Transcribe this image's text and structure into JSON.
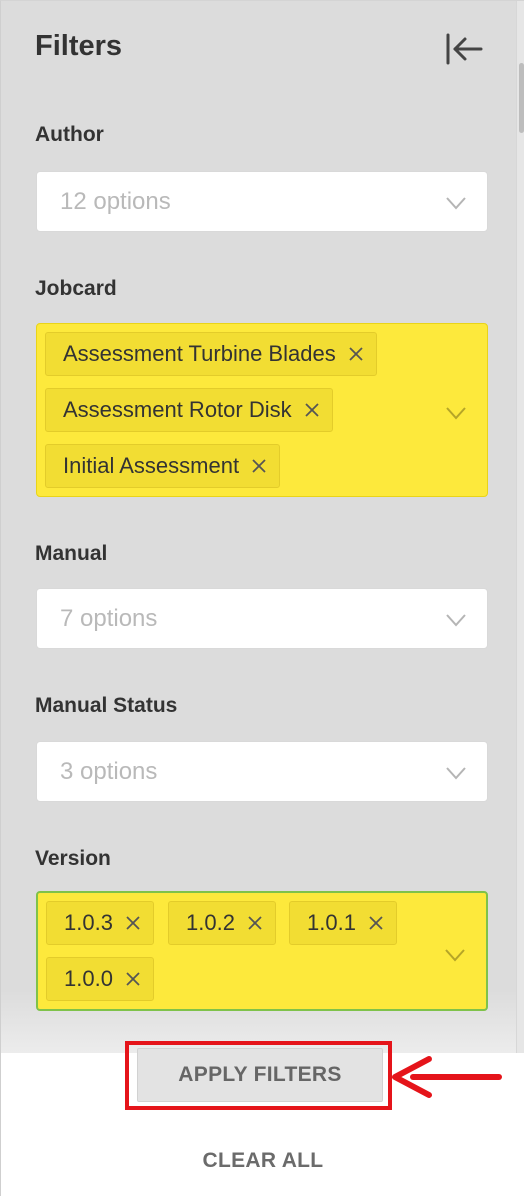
{
  "panel": {
    "title": "Filters",
    "collapse_icon": "collapse-left-icon"
  },
  "filters": {
    "author": {
      "label": "Author",
      "placeholder": "12 options"
    },
    "jobcard": {
      "label": "Jobcard",
      "tags": [
        "Assessment Turbine Blades",
        "Assessment Rotor Disk",
        "Initial Assessment"
      ]
    },
    "manual": {
      "label": "Manual",
      "placeholder": "7 options"
    },
    "manual_status": {
      "label": "Manual Status",
      "placeholder": "3 options"
    },
    "version": {
      "label": "Version",
      "tags": [
        "1.0.3",
        "1.0.2",
        "1.0.1",
        "1.0.0"
      ]
    }
  },
  "actions": {
    "apply_label": "APPLY FILTERS",
    "clear_label": "CLEAR ALL"
  },
  "icons": {
    "dropdown": "chevron-down-icon",
    "tag_remove": "close-icon",
    "annotation": "arrow-left-icon"
  },
  "colors": {
    "highlight": "#fde93c",
    "annotation_red": "#e5141a",
    "panel_bg": "#dcdcdc"
  }
}
